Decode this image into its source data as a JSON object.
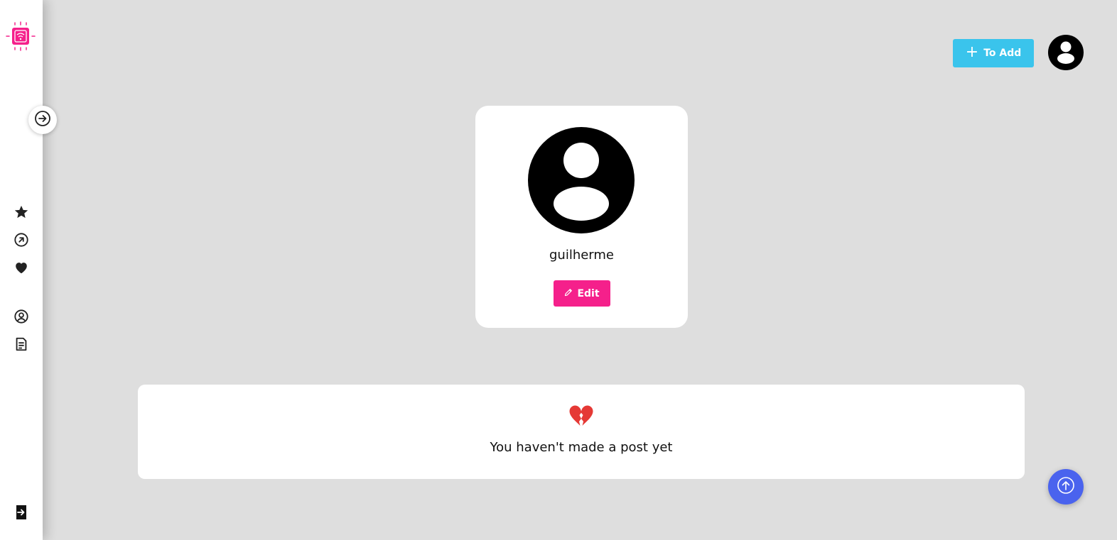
{
  "colors": {
    "background": "#dedede",
    "sidebar": "#ffffff",
    "brand_pink": "#f5208b",
    "add_button": "#3ac4ec",
    "scroll_button": "#4a63ee",
    "heart_red": "#e53935"
  },
  "sidebar": {
    "logo_icon": "wifi-chip-icon",
    "toggle_icon": "arrow-right-circle-icon",
    "items": [
      {
        "icon": "star-icon"
      },
      {
        "icon": "trending-arrow-circle-icon"
      },
      {
        "icon": "heart-icon"
      },
      {
        "icon": "user-circle-icon"
      },
      {
        "icon": "document-icon"
      }
    ],
    "logout_icon": "logout-icon"
  },
  "header": {
    "add_label": "To Add",
    "avatar_icon": "user-avatar-icon"
  },
  "profile": {
    "username": "guilherme",
    "edit_label": "Edit"
  },
  "posts": {
    "empty_icon": "broken-heart-icon",
    "empty_message": "You haven't made a post yet"
  },
  "scroll_top_icon": "arrow-up-circle-icon"
}
